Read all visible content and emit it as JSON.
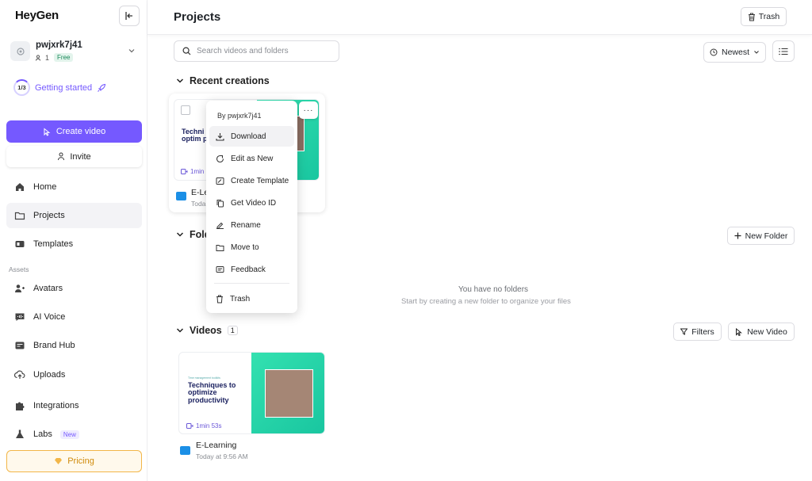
{
  "brand": {
    "logo": "HeyGen",
    "accent": "#7559ff"
  },
  "workspace": {
    "name": "pwjxrk7j41",
    "members": "1",
    "plan": "Free"
  },
  "getting_started": {
    "progress": "1/3",
    "label": "Getting started"
  },
  "sidebar": {
    "create_video": "Create video",
    "invite": "Invite",
    "items": [
      {
        "label": "Home",
        "icon": "home-icon"
      },
      {
        "label": "Projects",
        "icon": "folder-icon"
      },
      {
        "label": "Templates",
        "icon": "templates-icon"
      }
    ],
    "assets_label": "Assets",
    "asset_items": [
      {
        "label": "Avatars",
        "icon": "avatar-icon"
      },
      {
        "label": "AI Voice",
        "icon": "voice-icon"
      },
      {
        "label": "Brand Hub",
        "icon": "brand-icon"
      },
      {
        "label": "Uploads",
        "icon": "upload-icon"
      },
      {
        "label": "Integrations",
        "icon": "puzzle-icon"
      },
      {
        "label": "Labs",
        "icon": "labs-icon",
        "tag": "New"
      }
    ],
    "pricing": "Pricing"
  },
  "header": {
    "title": "Projects",
    "trash": "Trash"
  },
  "toolbar": {
    "search_placeholder": "Search videos and folders",
    "sort": "Newest"
  },
  "recent": {
    "title": "Recent creations",
    "card": {
      "name": "E-Le",
      "date": "Toda",
      "thumb_title": "Techni to optim produc",
      "thumb_small": "Time management toolkits",
      "duration": "1min"
    }
  },
  "context_menu": {
    "by": "By pwjxrk7j41",
    "items": [
      {
        "label": "Download",
        "icon": "download-icon"
      },
      {
        "label": "Edit as New",
        "icon": "edit-icon"
      },
      {
        "label": "Create Template",
        "icon": "template-icon"
      },
      {
        "label": "Get Video ID",
        "icon": "copy-icon"
      },
      {
        "label": "Rename",
        "icon": "rename-icon"
      },
      {
        "label": "Move to",
        "icon": "folder-icon"
      },
      {
        "label": "Feedback",
        "icon": "feedback-icon"
      },
      {
        "label": "Trash",
        "icon": "trash-icon"
      }
    ],
    "more": "···"
  },
  "folders": {
    "title": "Fold",
    "new_folder": "New Folder",
    "empty_title": "You have no folders",
    "empty_sub": "Start by creating a new folder to organize your files"
  },
  "videos": {
    "title": "Videos",
    "count": "1",
    "filters": "Filters",
    "new_video": "New Video",
    "items": [
      {
        "name": "E-Learning",
        "date": "Today at 9:56 AM",
        "duration": "1min 53s",
        "thumb_small": "Time management toolkits",
        "thumb_title": "Techniques to optimize productivity"
      }
    ]
  }
}
